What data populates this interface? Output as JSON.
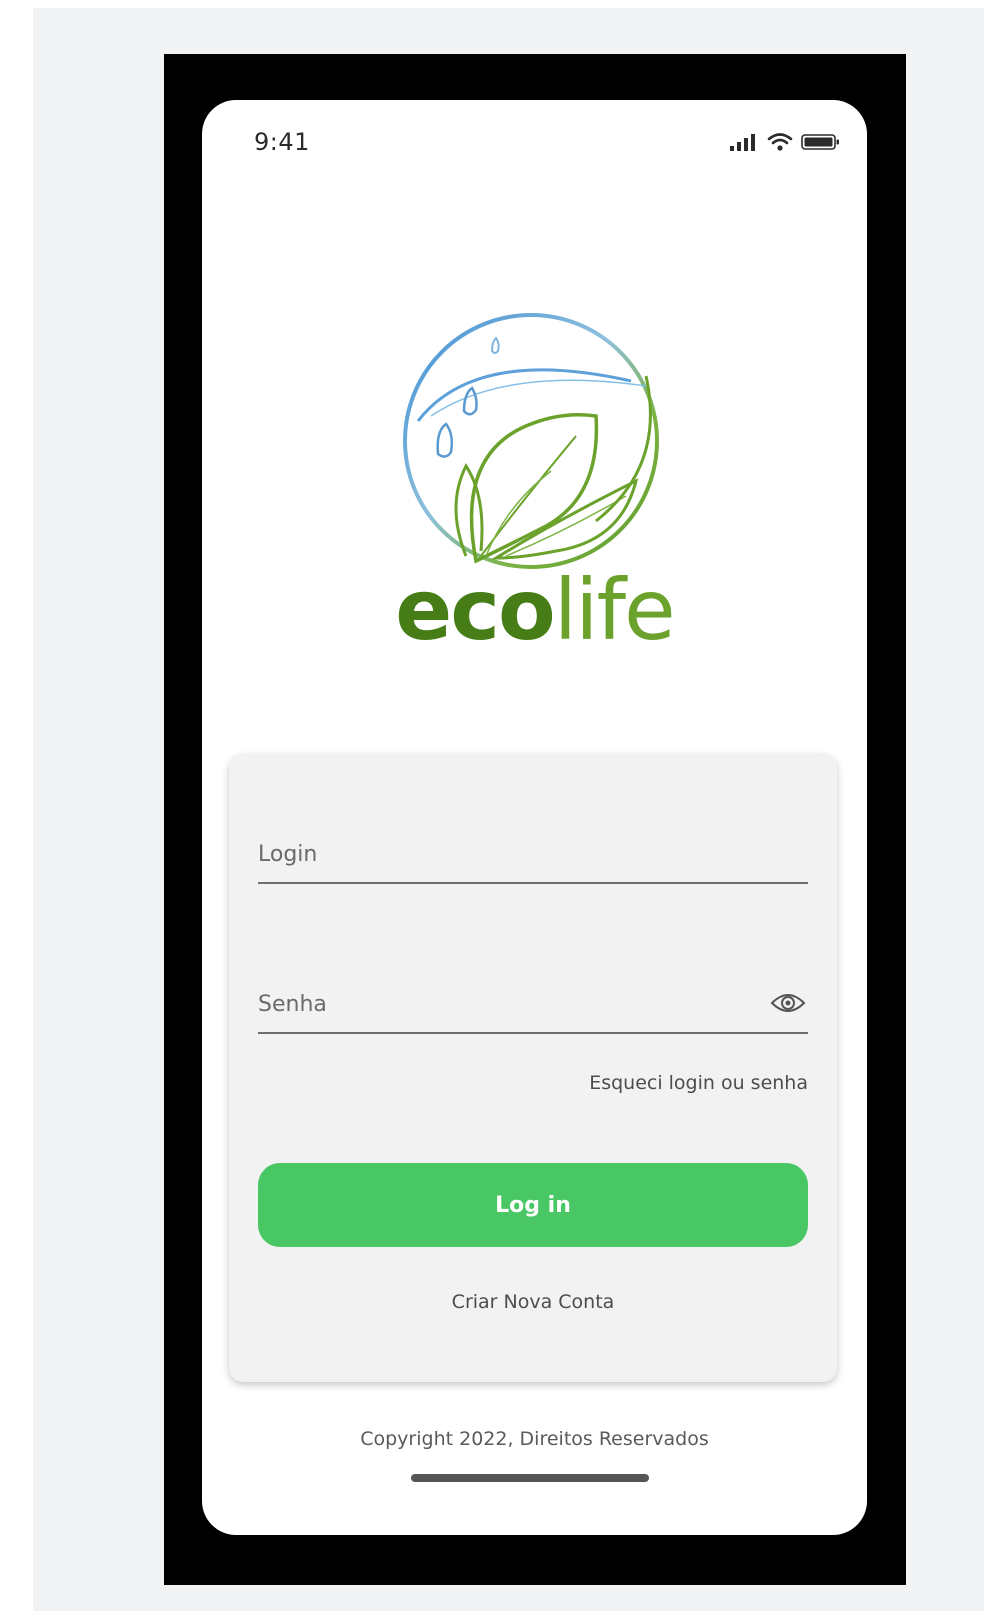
{
  "status_bar": {
    "time": "9:41",
    "icons": [
      "cellular-signal-icon",
      "wifi-icon",
      "battery-icon"
    ]
  },
  "brand": {
    "logo_icon": "leaf-water-logo-icon",
    "name_bold": "eco",
    "name_light": "life"
  },
  "form": {
    "login_placeholder": "Login",
    "password_placeholder": "Senha",
    "password_toggle_icon": "eye-icon",
    "forgot_label": "Esqueci login ou senha",
    "login_button_label": "Log in",
    "create_account_label": "Criar Nova Conta"
  },
  "footer": {
    "copyright": "Copyright 2022, Direitos Reservados"
  },
  "colors": {
    "primary_button": "#48c764",
    "brand_green": "#4f8b1f",
    "water_blue": "#4a8fd0",
    "card_background": "#f2f2f2"
  }
}
